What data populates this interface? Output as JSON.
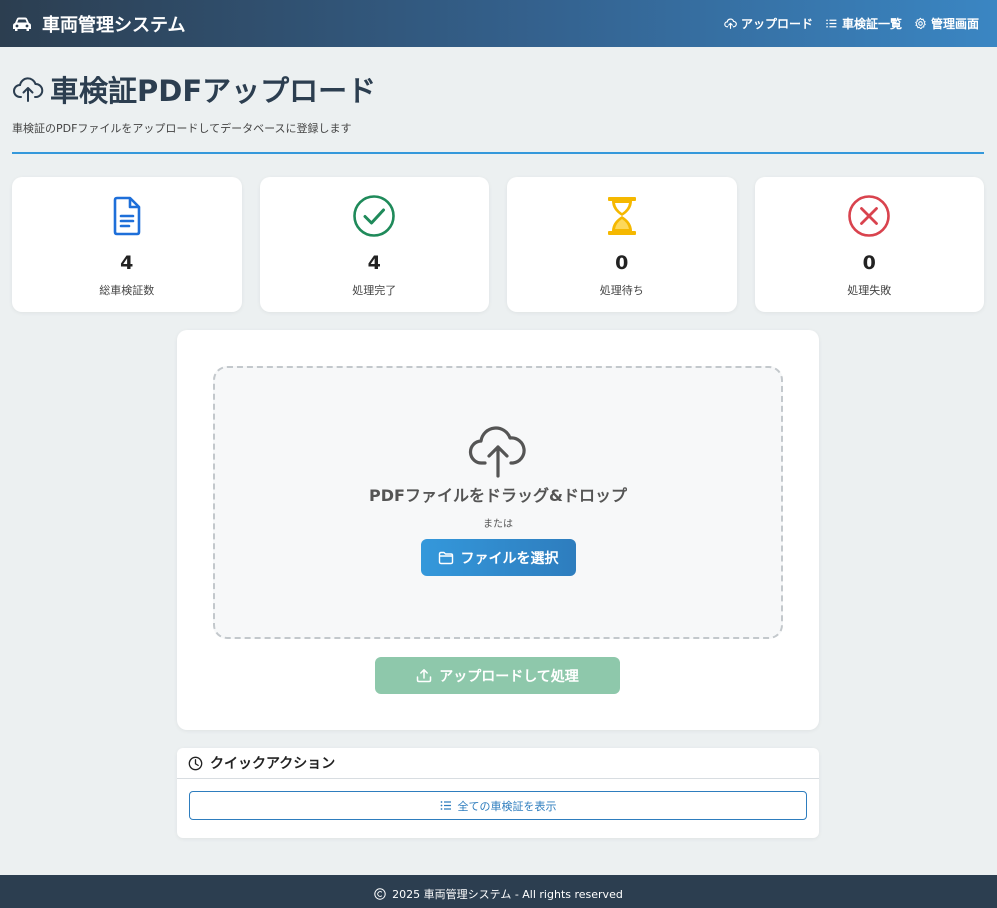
{
  "navbar": {
    "brand": "車両管理システム",
    "brand_icon": "car-icon",
    "links": [
      {
        "label": "アップロード",
        "icon": "cloud-upload-icon"
      },
      {
        "label": "車検証一覧",
        "icon": "list-icon"
      },
      {
        "label": "管理画面",
        "icon": "gear-icon"
      }
    ]
  },
  "header": {
    "title": "車検証PDFアップロード",
    "subtitle": "車検証のPDFファイルをアップロードしてデータベースに登録します",
    "icon": "cloud-upload-icon",
    "accent_color": "#3498db"
  },
  "stats": [
    {
      "value": "4",
      "label": "総車検証数",
      "icon": "document-icon",
      "color": "#1e6fd9"
    },
    {
      "value": "4",
      "label": "処理完了",
      "icon": "check-circle-icon",
      "color": "#1f8a5a"
    },
    {
      "value": "0",
      "label": "処理待ち",
      "icon": "hourglass-icon",
      "color": "#f5b800"
    },
    {
      "value": "0",
      "label": "処理失敗",
      "icon": "x-circle-icon",
      "color": "#d9434e"
    }
  ],
  "upload": {
    "drop_text": "PDFファイルをドラッグ&ドロップ",
    "or_text": "または",
    "select_label": "ファイルを選択",
    "submit_label": "アップロードして処理"
  },
  "quick_actions": {
    "title": "クイックアクション",
    "show_all_label": "全ての車検証を表示"
  },
  "footer": {
    "text": "2025 車両管理システム - All rights reserved"
  }
}
